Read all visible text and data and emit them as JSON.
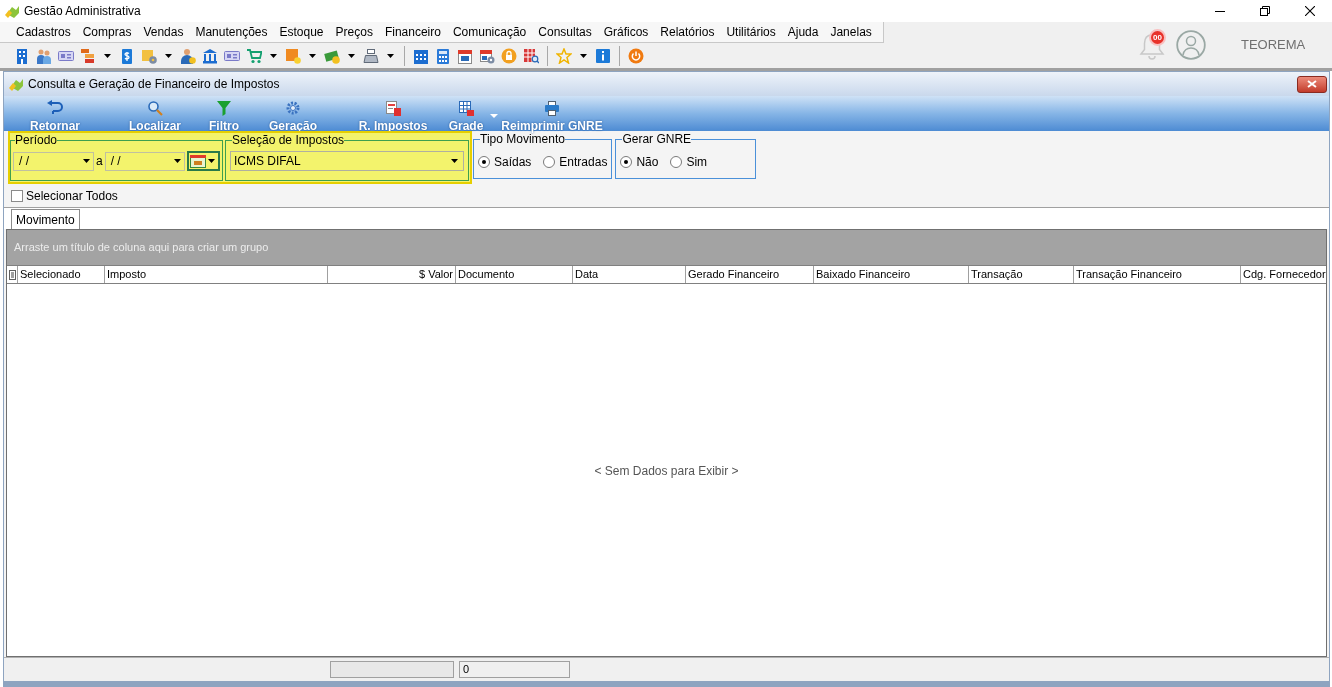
{
  "window": {
    "title": "Gestão Administrativa"
  },
  "menu": [
    "Cadastros",
    "Compras",
    "Vendas",
    "Manutenções",
    "Estoque",
    "Preços",
    "Financeiro",
    "Comunicação",
    "Consultas",
    "Gráficos",
    "Relatórios",
    "Utilitários",
    "Ajuda",
    "Janelas"
  ],
  "notifications": {
    "count": "00"
  },
  "user": {
    "name": "TEOREMA"
  },
  "form": {
    "title": "Consulta e Geração de Financeiro de Impostos",
    "toolbar": [
      {
        "label": "Retornar",
        "dropdown": false
      },
      {
        "label": "Localizar",
        "dropdown": false
      },
      {
        "label": "Filtro",
        "dropdown": false
      },
      {
        "label": "Geração",
        "dropdown": false
      },
      {
        "label": "R. Impostos",
        "dropdown": false
      },
      {
        "label": "Grade",
        "dropdown": true
      },
      {
        "label": "Reimprimir GNRE",
        "dropdown": false
      }
    ],
    "filters": {
      "highlighted": true,
      "period": {
        "label": "Período",
        "from": "/ /",
        "separator": "a",
        "to": "/ /"
      },
      "tax_selection": {
        "label": "Seleção de Impostos",
        "value": "ICMS DIFAL"
      }
    },
    "movement_type": {
      "label": "Tipo Movimento",
      "options": [
        {
          "label": "Saídas",
          "selected": true
        },
        {
          "label": "Entradas",
          "selected": false
        }
      ]
    },
    "generate_gnre": {
      "label": "Gerar GNRE",
      "options": [
        {
          "label": "Não",
          "selected": true
        },
        {
          "label": "Sim",
          "selected": false
        }
      ]
    },
    "select_all": {
      "label": "Selecionar Todos",
      "checked": false
    },
    "tabs": [
      {
        "label": "Movimento",
        "selected": true
      }
    ],
    "grid": {
      "group_hint": "Arraste um título de coluna aqui para criar um grupo",
      "columns": [
        {
          "label": "Selecionado",
          "kind": "text"
        },
        {
          "label": "Imposto",
          "kind": "text"
        },
        {
          "label": "$ Valor",
          "kind": "number"
        },
        {
          "label": "Documento",
          "kind": "text"
        },
        {
          "label": "Data",
          "kind": "text"
        },
        {
          "label": "Gerado Financeiro",
          "kind": "text"
        },
        {
          "label": "Baixado Financeiro",
          "kind": "text"
        },
        {
          "label": "Transação",
          "kind": "text"
        },
        {
          "label": "Transação Financeiro",
          "kind": "text"
        },
        {
          "label": "Cdg. Fornecedor",
          "kind": "text"
        }
      ],
      "empty_message": "< Sem Dados para Exibir >"
    },
    "status_bar": {
      "count": "0"
    }
  }
}
